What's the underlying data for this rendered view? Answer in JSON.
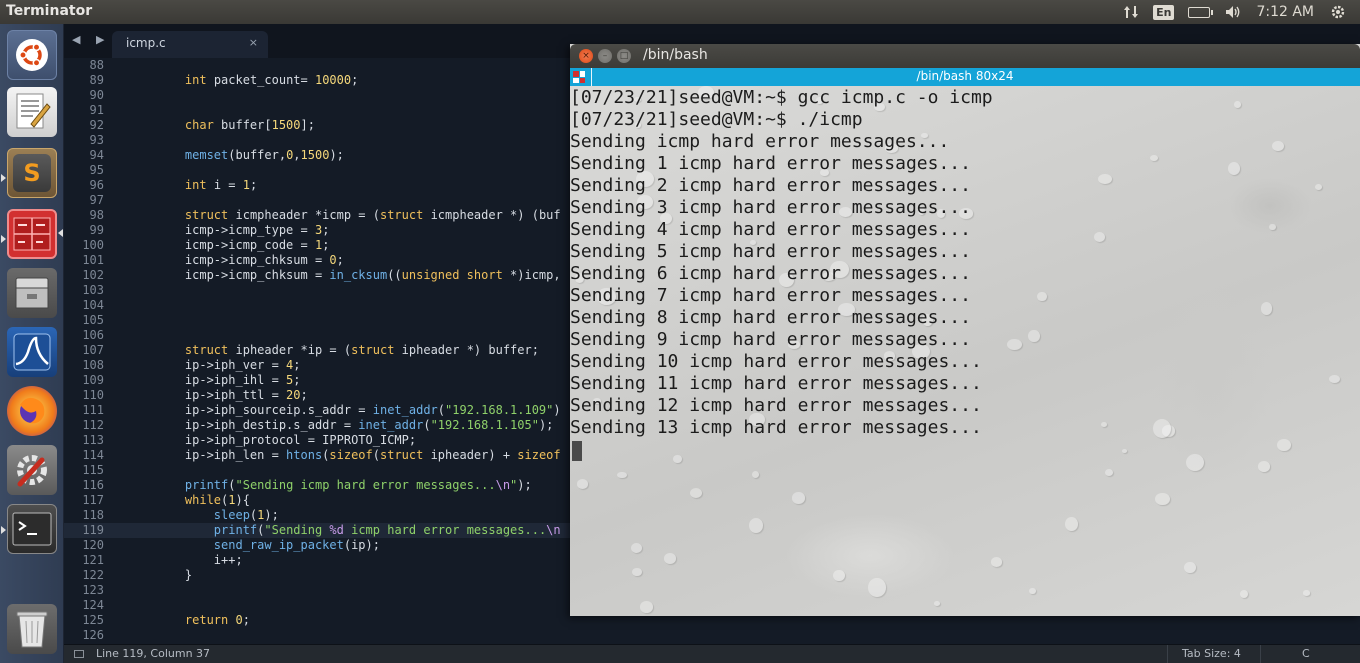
{
  "top_panel": {
    "app_title": "Terminator",
    "keyboard_layout": "En",
    "clock": "7:12 AM",
    "indicators": [
      "network-updown-icon",
      "keyboard-layout",
      "battery-icon",
      "volume-icon",
      "power-gear-icon"
    ]
  },
  "launcher": {
    "items": [
      "ubuntu-dash-icon",
      "text-editor-icon",
      "sublime-text-icon",
      "terminator-icon",
      "files-icon",
      "wireshark-icon",
      "firefox-icon",
      "system-settings-icon",
      "terminal-icon",
      "trash-icon"
    ],
    "letters": {
      "sublime": "S"
    }
  },
  "editor": {
    "tab_label": "icmp.c",
    "tab_close": "×",
    "nav_arrows": "◀ ▶",
    "highlight_line": 119,
    "lines": [
      {
        "n": "88",
        "code": ""
      },
      {
        "n": "89",
        "code": "    int packet_count= 10000;"
      },
      {
        "n": "90",
        "code": ""
      },
      {
        "n": "91",
        "code": ""
      },
      {
        "n": "92",
        "code": "    char buffer[1500];"
      },
      {
        "n": "93",
        "code": ""
      },
      {
        "n": "94",
        "code": "    memset(buffer,0,1500);"
      },
      {
        "n": "95",
        "code": ""
      },
      {
        "n": "96",
        "code": "    int i = 1;"
      },
      {
        "n": "97",
        "code": ""
      },
      {
        "n": "98",
        "code": "    struct icmpheader *icmp = (struct icmpheader *) (buf"
      },
      {
        "n": "99",
        "code": "    icmp->icmp_type = 3;"
      },
      {
        "n": "100",
        "code": "    icmp->icmp_code = 1;"
      },
      {
        "n": "101",
        "code": "    icmp->icmp_chksum = 0;"
      },
      {
        "n": "102",
        "code": "    icmp->icmp_chksum = in_cksum((unsigned short *)icmp,"
      },
      {
        "n": "103",
        "code": ""
      },
      {
        "n": "104",
        "code": ""
      },
      {
        "n": "105",
        "code": ""
      },
      {
        "n": "106",
        "code": ""
      },
      {
        "n": "107",
        "code": "    struct ipheader *ip = (struct ipheader *) buffer;"
      },
      {
        "n": "108",
        "code": "    ip->iph_ver = 4;"
      },
      {
        "n": "109",
        "code": "    ip->iph_ihl = 5;"
      },
      {
        "n": "110",
        "code": "    ip->iph_ttl = 20;"
      },
      {
        "n": "111",
        "code": "    ip->iph_sourceip.s_addr = inet_addr(\"192.168.1.109\")"
      },
      {
        "n": "112",
        "code": "    ip->iph_destip.s_addr = inet_addr(\"192.168.1.105\");"
      },
      {
        "n": "113",
        "code": "    ip->iph_protocol = IPPROTO_ICMP;"
      },
      {
        "n": "114",
        "code": "    ip->iph_len = htons(sizeof(struct ipheader) + sizeof"
      },
      {
        "n": "115",
        "code": ""
      },
      {
        "n": "116",
        "code": "    printf(\"Sending icmp hard error messages...\\n\");"
      },
      {
        "n": "117",
        "code": "    while(1){"
      },
      {
        "n": "118",
        "code": "        sleep(1);"
      },
      {
        "n": "119",
        "code": "        printf(\"Sending %d icmp hard error messages...\\n"
      },
      {
        "n": "120",
        "code": "        send_raw_ip_packet(ip);"
      },
      {
        "n": "121",
        "code": "        i++;"
      },
      {
        "n": "122",
        "code": "    }"
      },
      {
        "n": "123",
        "code": ""
      },
      {
        "n": "124",
        "code": ""
      },
      {
        "n": "125",
        "code": "    return 0;"
      },
      {
        "n": "126",
        "code": ""
      }
    ],
    "status": {
      "position": "Line 119, Column 37",
      "tab_size": "Tab Size: 4",
      "syntax": "C"
    }
  },
  "terminal": {
    "window_title": "/bin/bash",
    "header_title": "/bin/bash 80x24",
    "buttons": {
      "close": "×",
      "minimize": "–",
      "maximize": "□"
    },
    "lines": [
      "[07/23/21]seed@VM:~$ gcc icmp.c -o icmp",
      "[07/23/21]seed@VM:~$ ./icmp",
      "Sending icmp hard error messages...",
      "Sending 1 icmp hard error messages...",
      "Sending 2 icmp hard error messages...",
      "Sending 3 icmp hard error messages...",
      "Sending 4 icmp hard error messages...",
      "Sending 5 icmp hard error messages...",
      "Sending 6 icmp hard error messages...",
      "Sending 7 icmp hard error messages...",
      "Sending 8 icmp hard error messages...",
      "Sending 9 icmp hard error messages...",
      "Sending 10 icmp hard error messages...",
      "Sending 11 icmp hard error messages...",
      "Sending 12 icmp hard error messages...",
      "Sending 13 icmp hard error messages..."
    ]
  },
  "colors": {
    "editor_bg": "#141b26",
    "terminal_header": "#14a4d8",
    "keyword": "#f0c05c",
    "function": "#6fb1e6",
    "string": "#8fd16a",
    "launcher_bg": "#3b4a63"
  }
}
